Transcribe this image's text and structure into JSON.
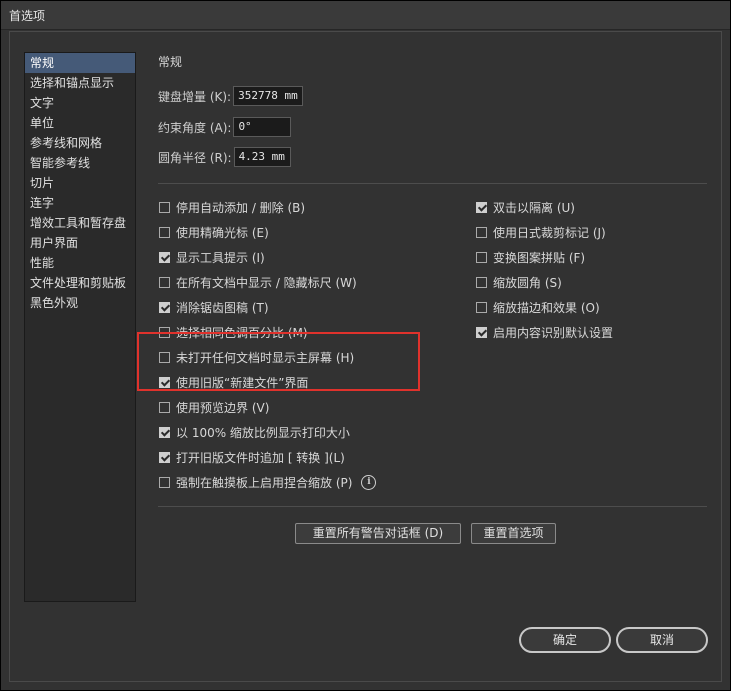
{
  "window": {
    "title": "首选项"
  },
  "sidebar": {
    "items": [
      {
        "label": "常规",
        "active": true
      },
      {
        "label": "选择和锚点显示"
      },
      {
        "label": "文字"
      },
      {
        "label": "单位"
      },
      {
        "label": "参考线和网格"
      },
      {
        "label": "智能参考线"
      },
      {
        "label": "切片"
      },
      {
        "label": "连字"
      },
      {
        "label": "增效工具和暂存盘"
      },
      {
        "label": "用户界面"
      },
      {
        "label": "性能"
      },
      {
        "label": "文件处理和剪贴板"
      },
      {
        "label": "黑色外观"
      }
    ]
  },
  "main": {
    "section_title": "常规",
    "fields": {
      "keyboard_increment": {
        "label": "键盘增量 (K):",
        "value": "352778 mm"
      },
      "constrain_angle": {
        "label": "约束角度 (A):",
        "value": "0°"
      },
      "corner_radius": {
        "label": "圆角半径 (R):",
        "value": "4.23 mm"
      }
    },
    "left_options": [
      {
        "label": "停用自动添加 / 删除 (B)",
        "checked": false
      },
      {
        "label": "使用精确光标 (E)",
        "checked": false
      },
      {
        "label": "显示工具提示 (I)",
        "checked": true
      },
      {
        "label": "在所有文档中显示 / 隐藏标尺 (W)",
        "checked": false
      },
      {
        "label": "消除锯齿图稿 (T)",
        "checked": true
      },
      {
        "label": "选择相同色调百分比 (M)",
        "checked": false
      },
      {
        "label": "未打开任何文档时显示主屏幕 (H)",
        "checked": false
      },
      {
        "label": "使用旧版“新建文件”界面",
        "checked": true
      },
      {
        "label": "使用预览边界 (V)",
        "checked": false
      },
      {
        "label": "以 100% 缩放比例显示打印大小",
        "checked": true
      },
      {
        "label": "打开旧版文件时追加 [ 转换 ](L)",
        "checked": true
      },
      {
        "label": "强制在触摸板上启用捏合缩放 (P)",
        "checked": false,
        "info_icon": "info-icon"
      }
    ],
    "right_options": [
      {
        "label": "双击以隔离 (U)",
        "checked": true
      },
      {
        "label": "使用日式裁剪标记 (J)",
        "checked": false
      },
      {
        "label": "变换图案拼贴 (F)",
        "checked": false
      },
      {
        "label": "缩放圆角 (S)",
        "checked": false
      },
      {
        "label": "缩放描边和效果 (O)",
        "checked": false
      },
      {
        "label": "启用内容识别默认设置",
        "checked": true
      }
    ],
    "reset_warnings_label": "重置所有警告对话框 (D)",
    "reset_prefs_label": "重置首选项"
  },
  "footer": {
    "ok_label": "确定",
    "cancel_label": "取消"
  },
  "colors": {
    "highlight": "#e0322c",
    "active_item": "#455a78"
  }
}
